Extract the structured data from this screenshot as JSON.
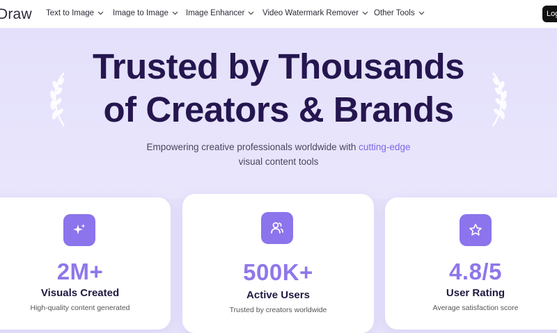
{
  "nav": {
    "logo": "Draw",
    "items": [
      {
        "label": "Text to Image"
      },
      {
        "label": "Image to Image"
      },
      {
        "label": "Image Enhancer"
      },
      {
        "label": "Video Watermark Remover"
      },
      {
        "label": "Other Tools"
      }
    ],
    "login_label": "Log"
  },
  "hero": {
    "title_line1": "Trusted by Thousands",
    "title_line2": "of Creators & Brands",
    "subtitle_pre": "Empowering creative professionals worldwide with ",
    "subtitle_highlight": "cutting-edge",
    "subtitle_post": "visual content tools"
  },
  "stats": [
    {
      "value": "2M+",
      "label": "Visuals Created",
      "desc": "High-quality content generated",
      "icon": "sparkle-icon"
    },
    {
      "value": "500K+",
      "label": "Active Users",
      "desc": "Trusted by creators worldwide",
      "icon": "users-icon"
    },
    {
      "value": "4.8/5",
      "label": "User Rating",
      "desc": "Average satisfaction score",
      "icon": "star-icon"
    }
  ],
  "colors": {
    "accent": "#8c74ec",
    "title": "#25164f",
    "hero_bg": "#e6e3fb"
  }
}
